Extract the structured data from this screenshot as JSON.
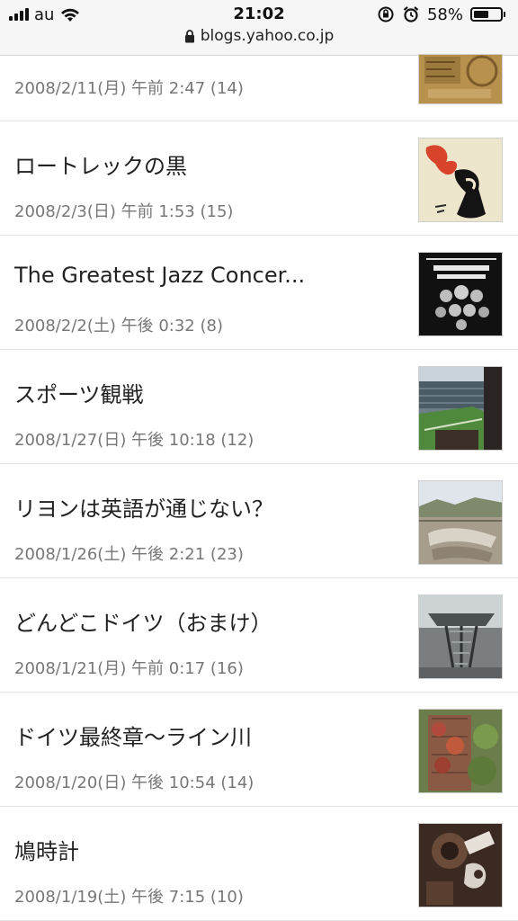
{
  "status_bar": {
    "carrier": "au",
    "time": "21:02",
    "battery_percent": "58%",
    "battery_level": 0.58
  },
  "address_bar": {
    "url": "blogs.yahoo.co.jp"
  },
  "posts": [
    {
      "title": "",
      "meta": "2008/2/11(月) 午前 2:47 (14)"
    },
    {
      "title": "ロートレックの黒",
      "meta": "2008/2/3(日) 午前 1:53 (15)"
    },
    {
      "title": "The Greatest Jazz Concer...",
      "meta": "2008/2/2(土) 午後 0:32 (8)"
    },
    {
      "title": "スポーツ観戦",
      "meta": "2008/1/27(日) 午後 10:18 (12)"
    },
    {
      "title": "リヨンは英語が通じない？",
      "meta": "2008/1/26(土) 午後 2:21 (23)"
    },
    {
      "title": "どんどこドイツ（おまけ）",
      "meta": "2008/1/21(月) 午前 0:17 (16)"
    },
    {
      "title": "ドイツ最終章〜ライン川",
      "meta": "2008/1/20(日) 午後 10:54 (14)"
    },
    {
      "title": "鳩時計",
      "meta": "2008/1/19(土) 午後 7:15 (10)"
    }
  ]
}
